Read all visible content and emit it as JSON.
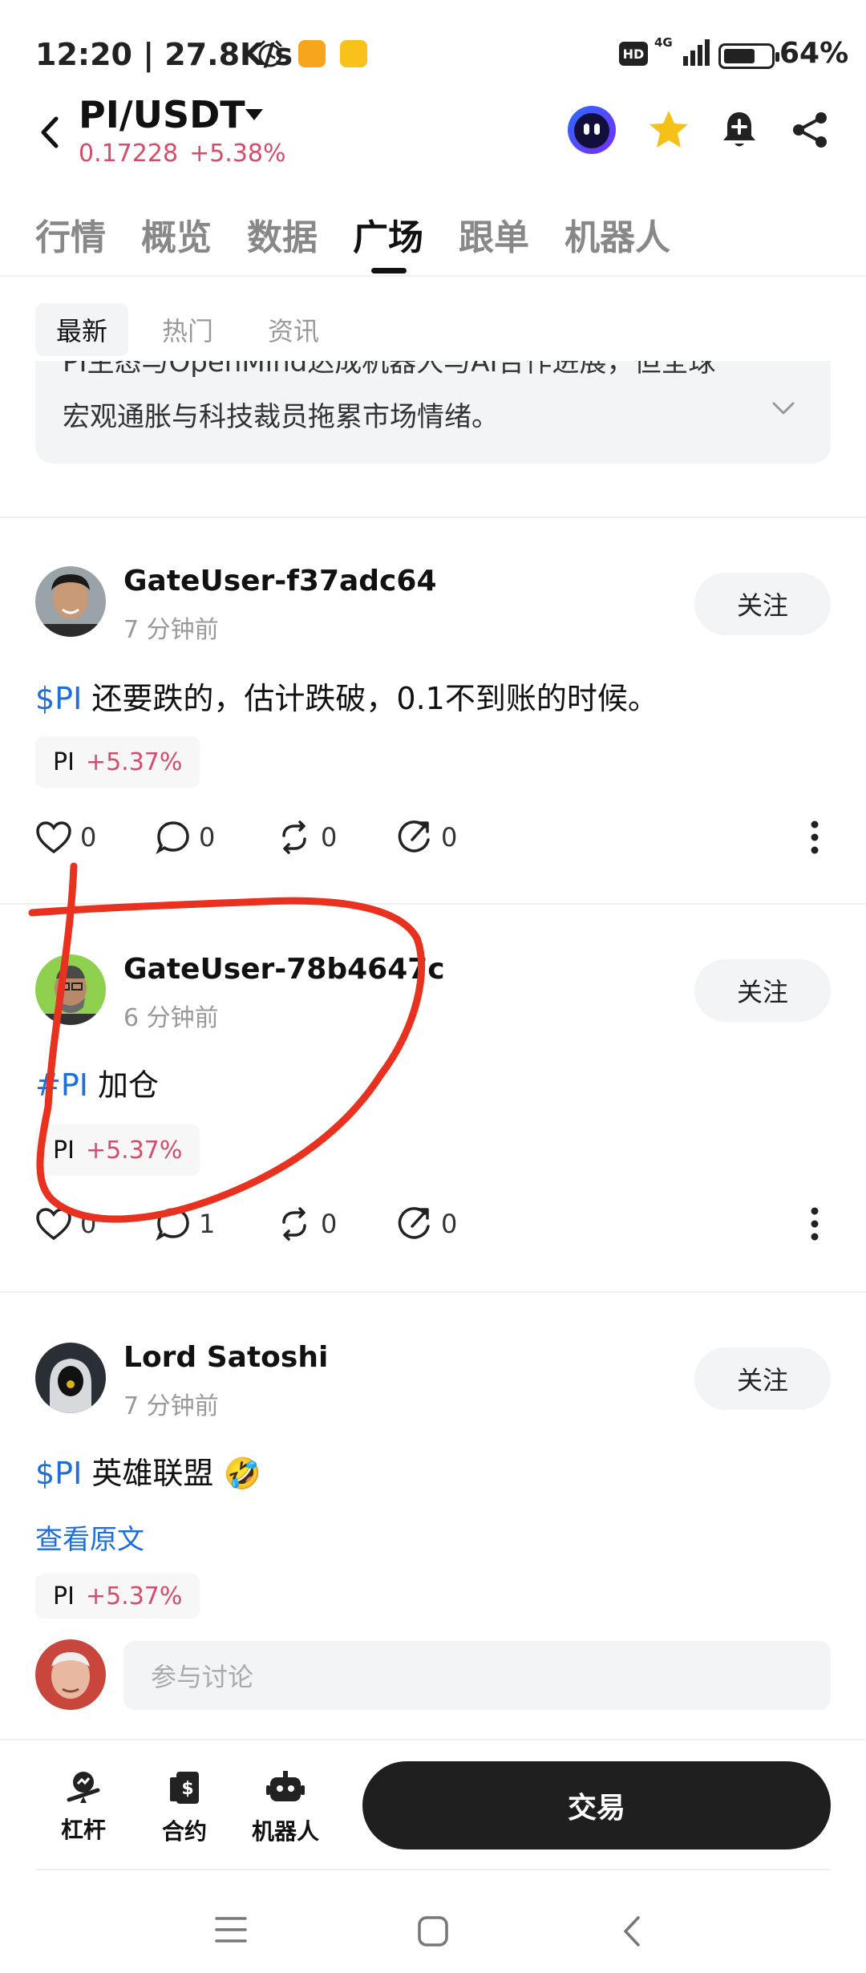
{
  "status_bar": {
    "time": "12:20 | 27.8K/s",
    "hd": "HD",
    "network": "4G",
    "battery": "64%"
  },
  "header": {
    "pair": "PI/USDT",
    "price": "0.17228",
    "change": "+5.38%"
  },
  "tabs": [
    "行情",
    "概览",
    "数据",
    "广场",
    "跟单",
    "机器人"
  ],
  "active_tab": "广场",
  "subtabs": [
    "最新",
    "热门",
    "资讯"
  ],
  "summary": {
    "line1": "PI生态与OpenMind达成机器人与AI合作进展，但全球",
    "line2": "宏观通胀与科技裁员拖累市场情绪。"
  },
  "posts": [
    {
      "username": "GateUser-f37adc64",
      "time_ago": "7 分钟前",
      "follow": "关注",
      "tag": "$PI",
      "text": " 还要跌的，估计跌破，0.1不到账的时候。",
      "chip_symbol": "PI",
      "chip_change": "+5.37%",
      "likes": "0",
      "comments": "0",
      "reposts": "0",
      "shares": "0"
    },
    {
      "username": "GateUser-78b4647c",
      "time_ago": "6 分钟前",
      "follow": "关注",
      "tag": "#PI",
      "text": " 加仓",
      "chip_symbol": "PI",
      "chip_change": "+5.37%",
      "likes": "0",
      "comments": "1",
      "reposts": "0",
      "shares": "0"
    },
    {
      "username": "Lord Satoshi",
      "time_ago": "7 分钟前",
      "follow": "关注",
      "tag": "$PI",
      "text": " 英雄联盟 🤣",
      "view_original": "查看原文",
      "chip_symbol": "PI",
      "chip_change": "+5.37%"
    }
  ],
  "comment_placeholder": "参与讨论",
  "bottom_nav": {
    "leverage": "杠杆",
    "contract": "合约",
    "robot": "机器人",
    "trade": "交易"
  },
  "colors": {
    "up_red": "#d64c6b",
    "link_blue": "#1e6fd9",
    "annotation_red": "#e8311f"
  }
}
